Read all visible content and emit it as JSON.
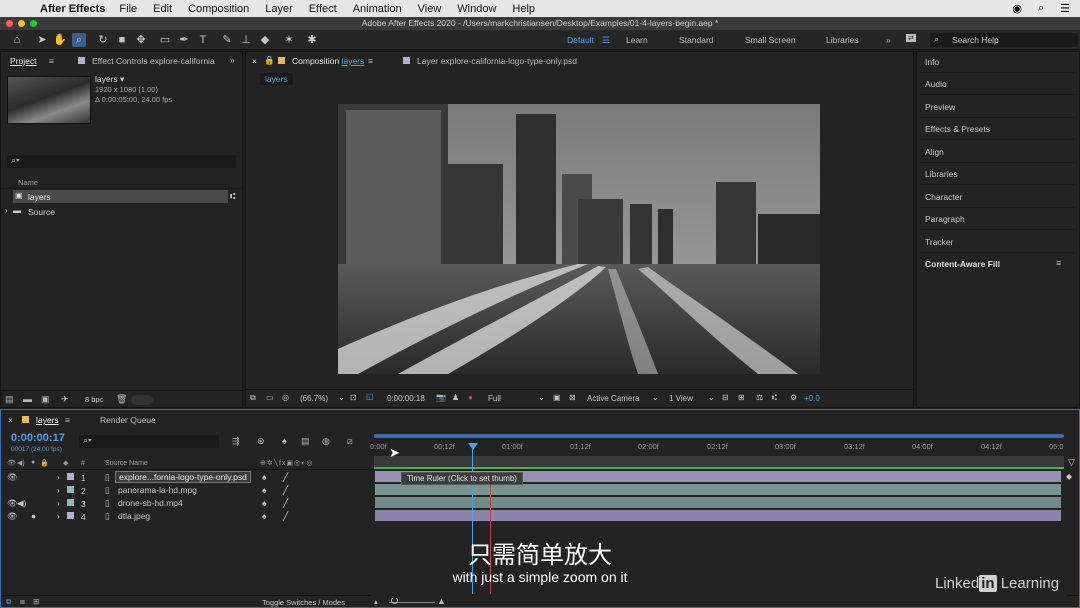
{
  "menubar": {
    "app_name": "After Effects",
    "items": [
      "File",
      "Edit",
      "Composition",
      "Layer",
      "Effect",
      "Animation",
      "View",
      "Window",
      "Help"
    ]
  },
  "window": {
    "title": "Adobe After Effects 2020 - /Users/markchristiansen/Desktop/Examples/01-4-layers-begin.aep *"
  },
  "toolbar": {
    "workspaces": {
      "default": "Default",
      "learn": "Learn",
      "standard": "Standard",
      "small_screen": "Small Screen",
      "libraries": "Libraries"
    },
    "search_placeholder": "Search Help"
  },
  "project_panel": {
    "tab_project": "Project",
    "tab_effect_controls": "Effect Controls explore-california",
    "comp_name": "layers ▾",
    "comp_res": "1920 x 1080 (1.00)",
    "comp_duration": "Δ 0:00:05:00, 24.00 fps",
    "column_name": "Name",
    "items": [
      {
        "name": "layers"
      },
      {
        "name": "Source"
      }
    ],
    "bpc": "8 bpc"
  },
  "composition_panel": {
    "tab_label": "Composition",
    "tab_comp": "layers",
    "tab_layer": "Layer explore-california-logo-type-only.psd",
    "breadcrumb": "layers",
    "zoom": "(66.7%)",
    "timecode": "0:00:00:18",
    "resolution": "Full",
    "camera": "Active Camera",
    "views": "1 View",
    "exposure": "+0.0"
  },
  "right_panel": {
    "items": [
      "Info",
      "Audio",
      "Preview",
      "Effects & Presets",
      "Align",
      "Libraries",
      "Character",
      "Paragraph",
      "Tracker",
      "Content-Aware Fill"
    ]
  },
  "timeline": {
    "tab_comp": "layers",
    "tab_render": "Render Queue",
    "current_time": "0:00:00:17",
    "frame_info": "00017 (24.00 fps)",
    "col_hash": "#",
    "col_source": "Source Name",
    "layers": [
      {
        "num": "1",
        "name": "explore...fornia-logo-type-only.psd",
        "color": "#b9a8d6"
      },
      {
        "num": "2",
        "name": "panorama-la-hd.mpg",
        "color": "#8fb8b0"
      },
      {
        "num": "3",
        "name": "drone-sb-hd.mp4",
        "color": "#8fb8b0"
      },
      {
        "num": "4",
        "name": "dtla.jpeg",
        "color": "#b9a8d6"
      }
    ],
    "ruler_labels": [
      "0:00f",
      "00:12f",
      "01:00f",
      "01:12f",
      "02:00f",
      "02:12f",
      "03:00f",
      "03:12f",
      "04:00f",
      "04:12f",
      "05:0"
    ],
    "tooltip": "Time Ruler (Click to set thumb)",
    "toggle_label": "Toggle Switches / Modes"
  },
  "subtitle": {
    "zh": "只需简单放大",
    "en": "with just a simple zoom on it"
  },
  "watermark": {
    "brand_pre": "Linked",
    "brand_in": "in",
    "brand_post": " Learning"
  }
}
